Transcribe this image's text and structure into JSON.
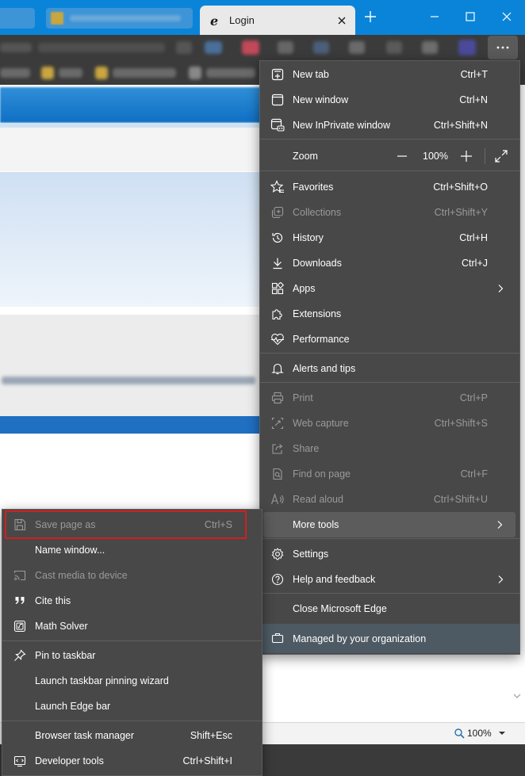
{
  "tab": {
    "title": "Login"
  },
  "page_status": {
    "zoom": "100%"
  },
  "main_menu": {
    "items": [
      {
        "label": "New tab",
        "shortcut": "Ctrl+T"
      },
      {
        "label": "New window",
        "shortcut": "Ctrl+N"
      },
      {
        "label": "New InPrivate window",
        "shortcut": "Ctrl+Shift+N"
      },
      {
        "label": "Zoom",
        "value": "100%"
      },
      {
        "label": "Favorites",
        "shortcut": "Ctrl+Shift+O"
      },
      {
        "label": "Collections",
        "shortcut": "Ctrl+Shift+Y"
      },
      {
        "label": "History",
        "shortcut": "Ctrl+H"
      },
      {
        "label": "Downloads",
        "shortcut": "Ctrl+J"
      },
      {
        "label": "Apps"
      },
      {
        "label": "Extensions"
      },
      {
        "label": "Performance"
      },
      {
        "label": "Alerts and tips"
      },
      {
        "label": "Print",
        "shortcut": "Ctrl+P"
      },
      {
        "label": "Web capture",
        "shortcut": "Ctrl+Shift+S"
      },
      {
        "label": "Share"
      },
      {
        "label": "Find on page",
        "shortcut": "Ctrl+F"
      },
      {
        "label": "Read aloud",
        "shortcut": "Ctrl+Shift+U"
      },
      {
        "label": "More tools"
      },
      {
        "label": "Settings"
      },
      {
        "label": "Help and feedback"
      },
      {
        "label": "Close Microsoft Edge"
      },
      {
        "label": "Managed by your organization"
      }
    ]
  },
  "more_tools_menu": {
    "items": [
      {
        "label": "Save page as",
        "shortcut": "Ctrl+S"
      },
      {
        "label": "Name window..."
      },
      {
        "label": "Cast media to device"
      },
      {
        "label": "Cite this"
      },
      {
        "label": "Math Solver"
      },
      {
        "label": "Pin to taskbar"
      },
      {
        "label": "Launch taskbar pinning wizard"
      },
      {
        "label": "Launch Edge bar"
      },
      {
        "label": "Browser task manager",
        "shortcut": "Shift+Esc"
      },
      {
        "label": "Developer tools",
        "shortcut": "Ctrl+Shift+I"
      }
    ]
  },
  "colors": {
    "titlebar": "#0a84d9",
    "menu_bg": "#484848",
    "highlight": "#d21f1f",
    "managed_bg": "#4e5a63"
  }
}
